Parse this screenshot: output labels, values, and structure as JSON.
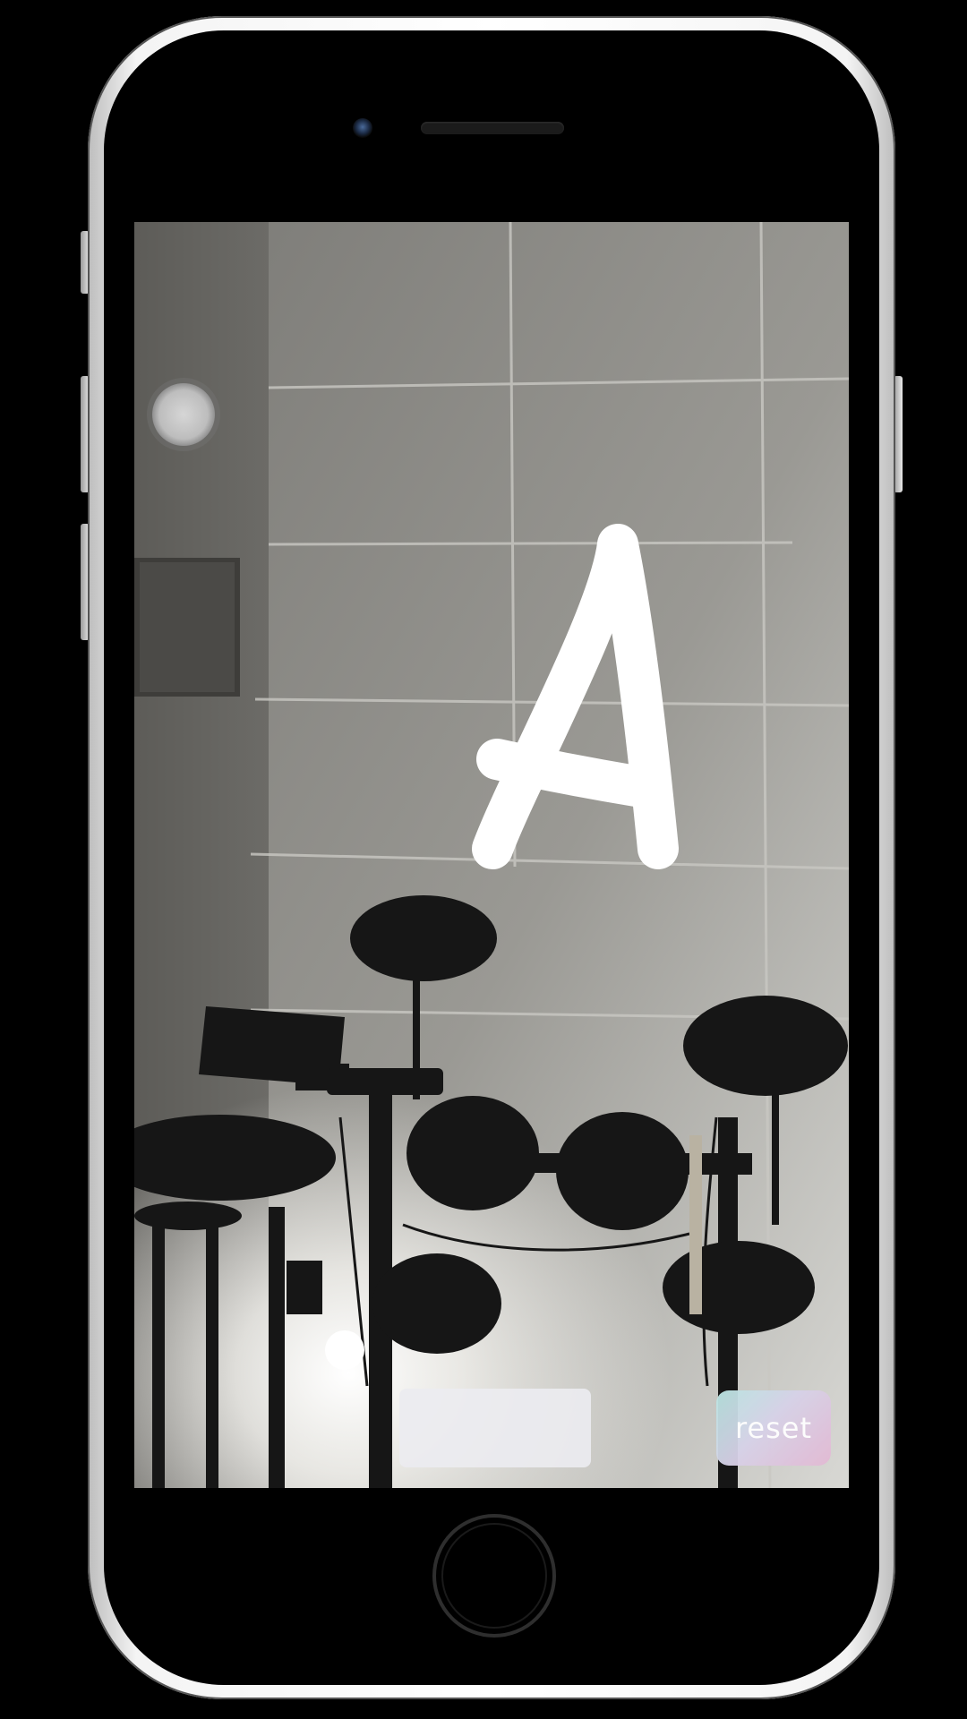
{
  "app": {
    "reset_label": "reset",
    "blank_button_label": ""
  },
  "drawing": {
    "stroke_color": "#ffffff",
    "letter_drawn": "A"
  },
  "colors": {
    "background": "#000000",
    "phone_frame": "#f4f4f4",
    "reset_gradient_start": "#b9e6e2",
    "reset_gradient_end": "#e3b9d4",
    "blank_button": "#ebebf0"
  },
  "icons": {
    "record": "record-circle-icon",
    "home": "home-button-icon",
    "camera": "front-camera-icon"
  }
}
